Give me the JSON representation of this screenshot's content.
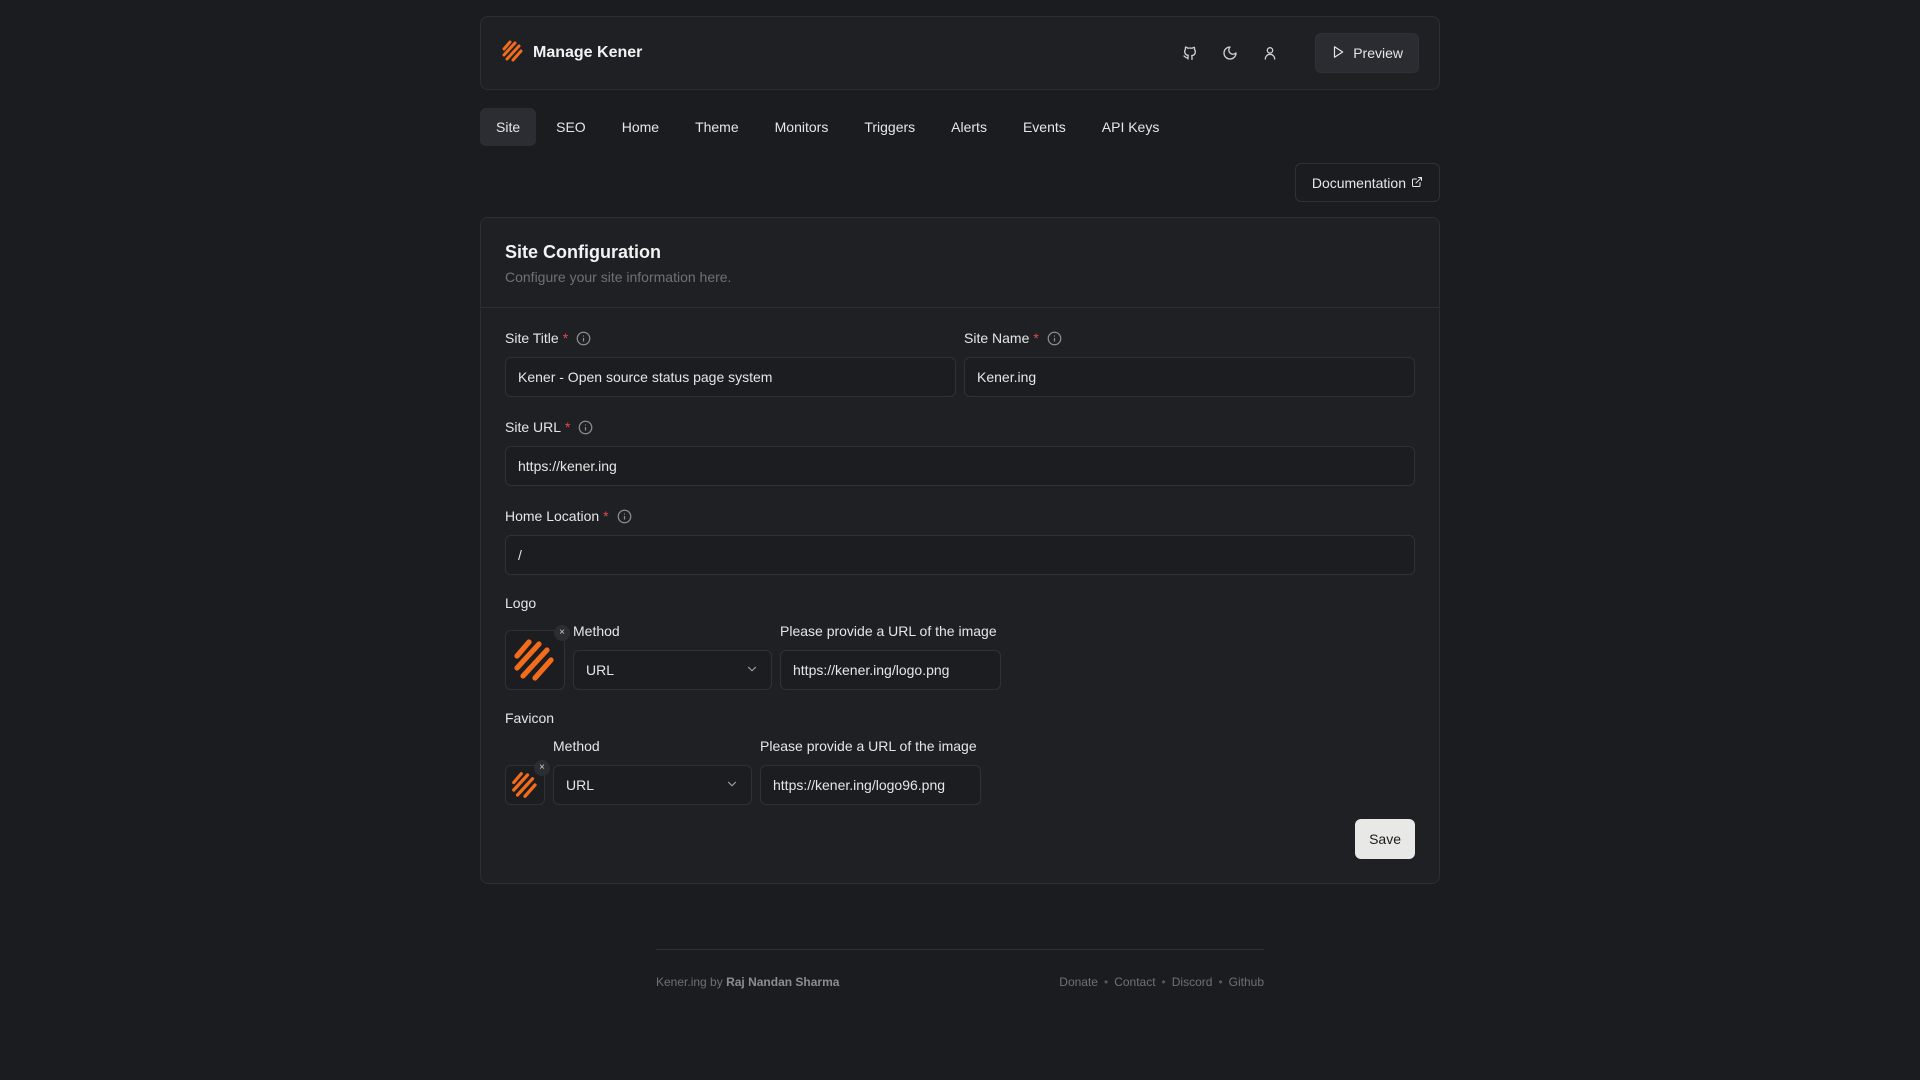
{
  "header": {
    "title": "Manage Kener",
    "preview_label": "Preview",
    "icons": [
      "github-icon",
      "moon-icon",
      "user-icon"
    ],
    "logo_color": "#f26c1c"
  },
  "tabs": [
    {
      "label": "Site",
      "active": true
    },
    {
      "label": "SEO"
    },
    {
      "label": "Home"
    },
    {
      "label": "Theme"
    },
    {
      "label": "Monitors"
    },
    {
      "label": "Triggers"
    },
    {
      "label": "Alerts"
    },
    {
      "label": "Events"
    },
    {
      "label": "API Keys"
    }
  ],
  "documentation_label": "Documentation",
  "card": {
    "title": "Site Configuration",
    "subtitle": "Configure your site information here.",
    "site_title": {
      "label": "Site Title",
      "required": "*",
      "value": "Kener - Open source status page system"
    },
    "site_name": {
      "label": "Site Name",
      "required": "*",
      "value": "Kener.ing"
    },
    "site_url": {
      "label": "Site URL",
      "required": "*",
      "value": "https://kener.ing"
    },
    "home_location": {
      "label": "Home Location",
      "required": "*",
      "value": "/"
    },
    "logo": {
      "label": "Logo",
      "method_label": "Method",
      "method_value": "URL",
      "url_label": "Please provide a URL of the image",
      "url_value": "https://kener.ing/logo.png",
      "remove": "×"
    },
    "favicon": {
      "label": "Favicon",
      "method_label": "Method",
      "method_value": "URL",
      "url_label": "Please provide a URL of the image",
      "url_value": "https://kener.ing/logo96.png",
      "remove": "×"
    },
    "save_label": "Save"
  },
  "footer": {
    "prefix": "Kener.ing by",
    "author": "Raj Nandan Sharma",
    "links": [
      "Donate",
      "Contact",
      "Discord",
      "Github"
    ],
    "separator": "•"
  },
  "colors": {
    "background": "#1b1c20",
    "accent": "#f26c1c",
    "required": "#e5484d"
  }
}
